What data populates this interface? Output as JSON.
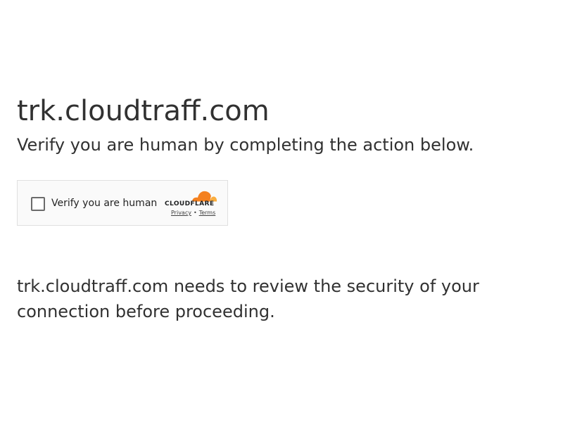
{
  "page": {
    "title": "trk.cloudtraff.com",
    "subtitle": "Verify you are human by completing the action below.",
    "message": "trk.cloudtraff.com needs to review the security of your connection before proceeding."
  },
  "challenge": {
    "checkbox_label": "Verify you are human",
    "checked": false,
    "brand": {
      "wordmark": "CLOUDFLARE",
      "logo_icon": "cloudflare-cloud-icon",
      "accent_color": "#f48120",
      "accent_light": "#faad3f"
    },
    "links": {
      "privacy": "Privacy",
      "separator": "•",
      "terms": "Terms"
    }
  },
  "colors": {
    "text": "#313131",
    "widget_bg": "#fafafa",
    "widget_border": "#e0e0e0"
  }
}
